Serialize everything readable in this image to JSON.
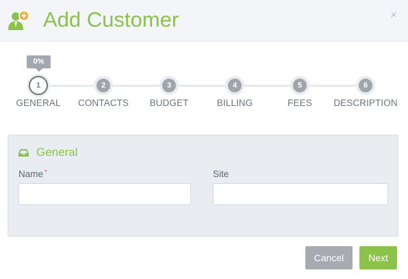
{
  "dialog": {
    "title": "Add Customer",
    "close_symbol": "×"
  },
  "wizard": {
    "progress": "0%",
    "progress_value": 0,
    "active_step": 1,
    "steps": [
      {
        "number": "1",
        "label": "GENERAL"
      },
      {
        "number": "2",
        "label": "CONTACTS"
      },
      {
        "number": "3",
        "label": "BUDGET"
      },
      {
        "number": "4",
        "label": "BILLING"
      },
      {
        "number": "5",
        "label": "FEES"
      },
      {
        "number": "6",
        "label": "DESCRIPTION"
      }
    ]
  },
  "panel": {
    "title": "General",
    "icon": "inbox-icon",
    "fields": [
      {
        "label": "Name",
        "required_mark": "*",
        "value": ""
      },
      {
        "label": "Site",
        "value": ""
      }
    ]
  },
  "footer": {
    "cancel_label": "Cancel",
    "next_label": "Next"
  },
  "colors": {
    "accent": "#8bc34a",
    "step": "#a0a5ab",
    "panel_bg": "#e9edf2"
  }
}
